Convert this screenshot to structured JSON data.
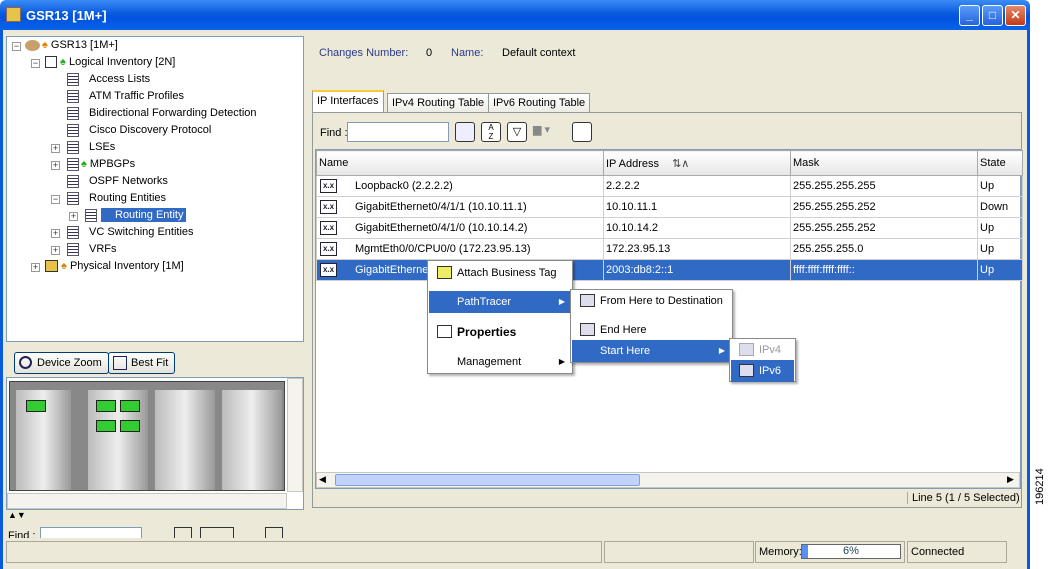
{
  "window": {
    "title": "GSR13 [1M+]",
    "minimize_icon": "minimize-icon",
    "maximize_icon": "maximize-icon",
    "close_icon": "close-icon"
  },
  "tree": {
    "root": "GSR13 [1M+]",
    "logical": "Logical Inventory [2N]",
    "items": [
      "Access Lists",
      "ATM Traffic Profiles",
      "Bidirectional Forwarding Detection",
      "Cisco Discovery Protocol",
      "LSEs",
      "MPBGPs",
      "OSPF Networks",
      "Routing Entities",
      "Routing Entity",
      "VC Switching Entities",
      "VRFs"
    ],
    "physical": "Physical Inventory [1M]"
  },
  "zoom": {
    "device_zoom": "Device Zoom",
    "best_fit": "Best Fit"
  },
  "header": {
    "changes_label": "Changes Number:",
    "changes_value": "0",
    "name_label": "Name:",
    "name_value": "Default context"
  },
  "tabs": [
    "IP Interfaces",
    "IPv4 Routing Table",
    "IPv6 Routing Table"
  ],
  "toolbar": {
    "find_label": "Find :"
  },
  "table": {
    "columns": [
      "Name",
      "IP Address",
      "Mask",
      "State"
    ],
    "rows": [
      {
        "name": "Loopback0 (2.2.2.2)",
        "ip": "2.2.2.2",
        "mask": "255.255.255.255",
        "state": "Up"
      },
      {
        "name": "GigabitEthernet0/4/1/1 (10.10.11.1)",
        "ip": "10.10.11.1",
        "mask": "255.255.255.252",
        "state": "Down"
      },
      {
        "name": "GigabitEthernet0/4/1/0 (10.10.14.2)",
        "ip": "10.10.14.2",
        "mask": "255.255.255.252",
        "state": "Up"
      },
      {
        "name": "MgmtEth0/0/CPU0/0 (172.23.95.13)",
        "ip": "172.23.95.13",
        "mask": "255.255.255.0",
        "state": "Up"
      },
      {
        "name": "GigabitEthernet",
        "ip": "2003:db8:2::1",
        "mask": "ffff:ffff:ffff:ffff::",
        "state": "Up"
      }
    ],
    "status": "Line 5 (1 / 5 Selected)"
  },
  "context_menu": {
    "items": [
      "Attach Business Tag",
      "PathTracer",
      "Properties",
      "Management"
    ],
    "pathtracer": [
      "From Here to Destination",
      "End Here",
      "Start Here"
    ],
    "start_here": [
      "IPv4",
      "IPv6"
    ]
  },
  "bottom": {
    "find_label": "Find :"
  },
  "statusbar": {
    "memory_label": "Memory:",
    "memory_value": "6%",
    "connection": "Connected"
  },
  "side_caption": "196214"
}
